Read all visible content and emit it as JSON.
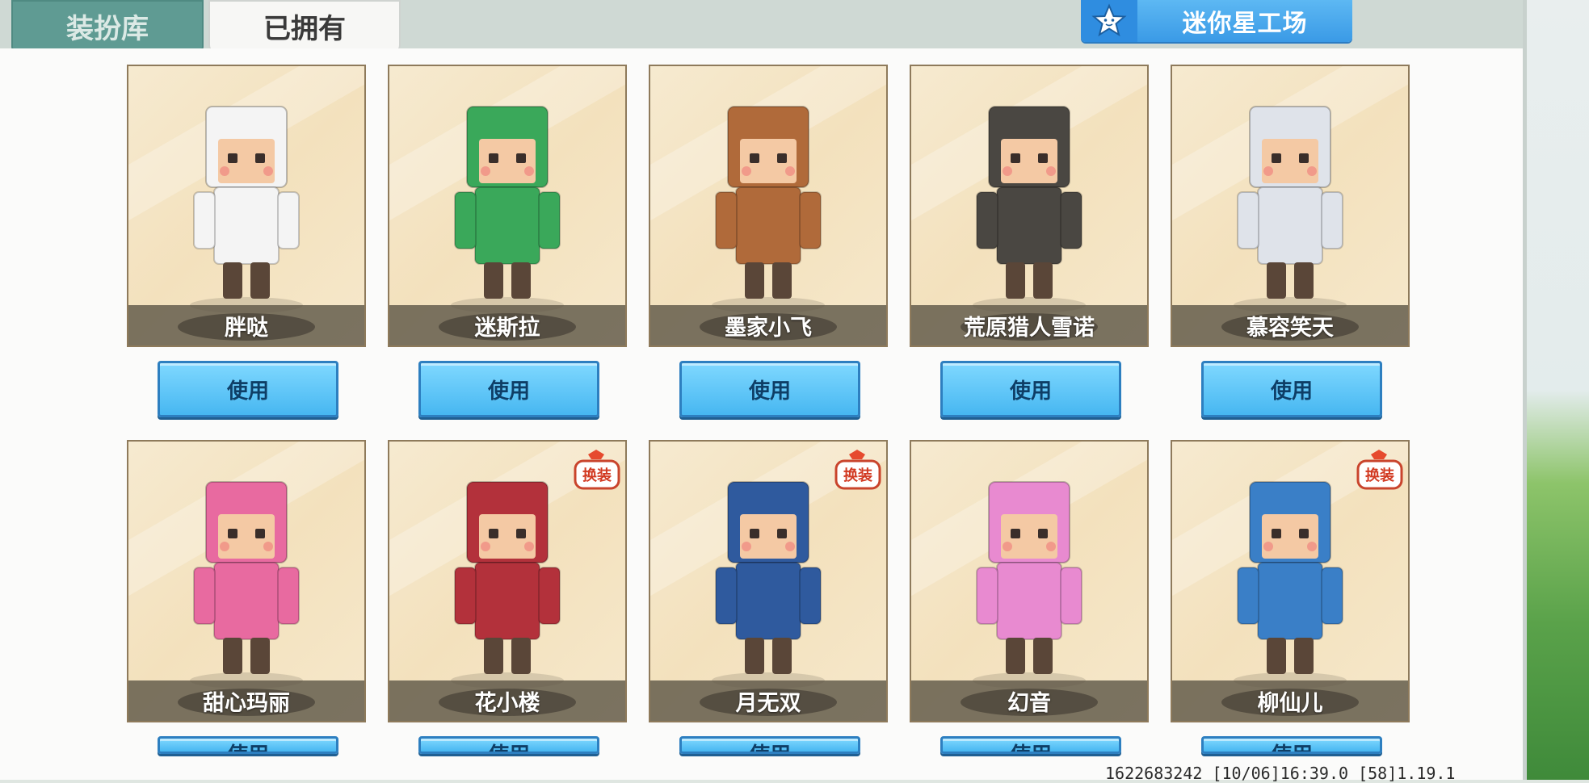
{
  "tabs": [
    {
      "label": "装扮库",
      "active": false
    },
    {
      "label": "已拥有",
      "active": true
    }
  ],
  "workshop": {
    "label": "迷你星工场",
    "icon": "star-icon"
  },
  "accent": "#47b7f1",
  "use_label": "使用",
  "badge_label": "换装",
  "skins": [
    {
      "name": "胖哒",
      "color": "#f4f4f4",
      "badge": false
    },
    {
      "name": "迷斯拉",
      "color": "#3aa85a",
      "badge": false
    },
    {
      "name": "墨家小飞",
      "color": "#b06a3a",
      "badge": false
    },
    {
      "name": "荒原猎人雪诺",
      "color": "#4a4742",
      "badge": false
    },
    {
      "name": "慕容笑天",
      "color": "#dfe3ea",
      "badge": false
    },
    {
      "name": "甜心玛丽",
      "color": "#e86aa0",
      "badge": false
    },
    {
      "name": "花小楼",
      "color": "#b3313b",
      "badge": true
    },
    {
      "name": "月无双",
      "color": "#2f5a9e",
      "badge": true
    },
    {
      "name": "幻音",
      "color": "#e88ad0",
      "badge": false
    },
    {
      "name": "柳仙儿",
      "color": "#3a7fc7",
      "badge": true
    }
  ],
  "footer": "1622683242 [10/06]16:39.0 [58]1.19.1"
}
